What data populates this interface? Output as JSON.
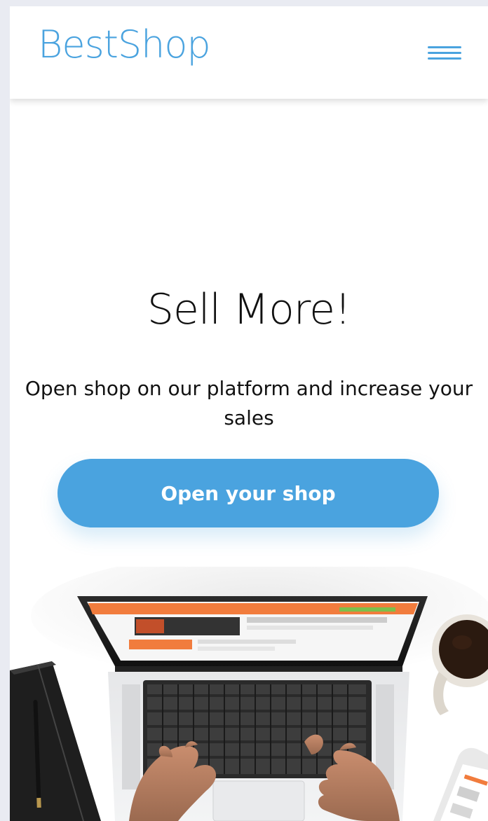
{
  "header": {
    "brand": "BestShop",
    "menu_icon": "hamburger-menu-icon"
  },
  "hero": {
    "title": "Sell More!",
    "subtitle": "Open shop on our platform and increase your sales",
    "cta_label": "Open your shop"
  },
  "image": {
    "description_icon": "laptop-workspace-illustration"
  },
  "colors": {
    "accent": "#4aa3df",
    "text": "#111111",
    "background": "#ffffff",
    "page_frame": "#e9ebf2"
  }
}
